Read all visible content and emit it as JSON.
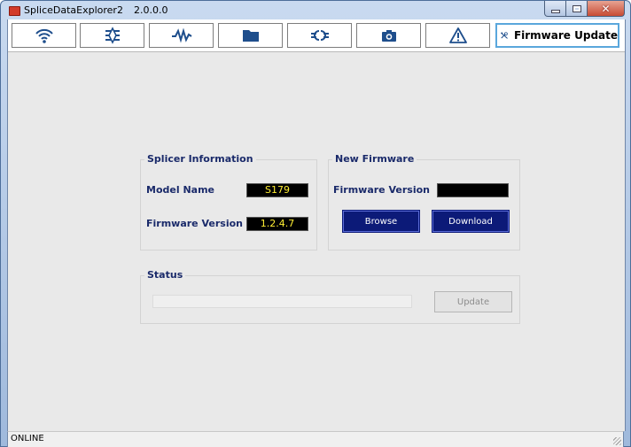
{
  "window": {
    "title": "SpliceDataExplorer2",
    "version": "2.0.0.0"
  },
  "toolbar": {
    "tabs": [
      {
        "icon": "wifi-icon"
      },
      {
        "icon": "splice-list-icon"
      },
      {
        "icon": "waveform-icon"
      },
      {
        "icon": "folder-icon"
      },
      {
        "icon": "fiber-splice-icon"
      },
      {
        "icon": "camera-icon"
      },
      {
        "icon": "warning-icon"
      },
      {
        "icon": "tools-icon",
        "label": "Firmware Update",
        "active": true
      }
    ]
  },
  "splicer_info": {
    "title": "Splicer Information",
    "model_name_label": "Model Name",
    "model_name_value": "S179",
    "firmware_version_label": "Firmware Version",
    "firmware_version_value": "1.2.4.7"
  },
  "new_firmware": {
    "title": "New Firmware",
    "firmware_version_label": "Firmware Version",
    "firmware_version_value": "",
    "browse_label": "Browse",
    "download_label": "Download"
  },
  "status": {
    "title": "Status",
    "progress": 0,
    "update_label": "Update"
  },
  "statusbar": {
    "text": "ONLINE"
  },
  "colors": {
    "label_text": "#1a2a6a",
    "value_text": "#ffee33",
    "button_bg": "#0c1a78",
    "active_tab_border": "#5aa7dc"
  }
}
